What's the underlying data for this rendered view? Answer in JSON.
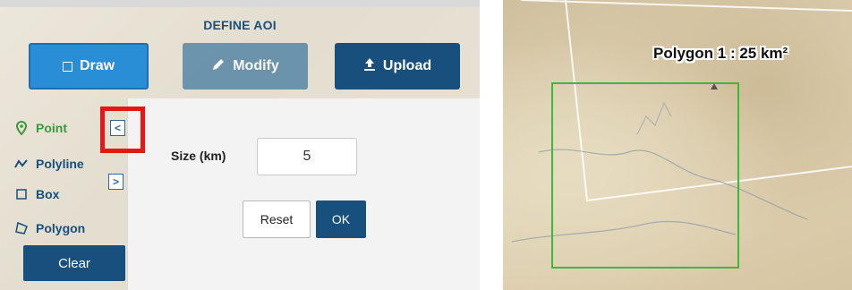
{
  "header": {
    "title": "DEFINE AOI"
  },
  "toolbar": {
    "draw_label": "Draw",
    "modify_label": "Modify",
    "upload_label": "Upload"
  },
  "menu": {
    "items": [
      {
        "label": "Point",
        "icon": "map-pin-icon",
        "active": true
      },
      {
        "label": "Polyline",
        "icon": "polyline-icon",
        "active": false
      },
      {
        "label": "Box",
        "icon": "box-icon",
        "active": false
      },
      {
        "label": "Polygon",
        "icon": "polygon-icon",
        "active": false
      }
    ],
    "clear_label": "Clear",
    "collapse_glyph": "<",
    "expand_glyph": ">"
  },
  "point_panel": {
    "size_label": "Size (km)",
    "size_value": "5",
    "reset_label": "Reset",
    "ok_label": "OK"
  },
  "map": {
    "polygon_label": "Polygon 1 : 25 km²"
  },
  "colors": {
    "accent_blue": "#2a8ed6",
    "dark_blue": "#17507c",
    "active_green": "#3a9a3a",
    "highlight_red": "#e51717",
    "polygon_green": "#3cb83c"
  }
}
